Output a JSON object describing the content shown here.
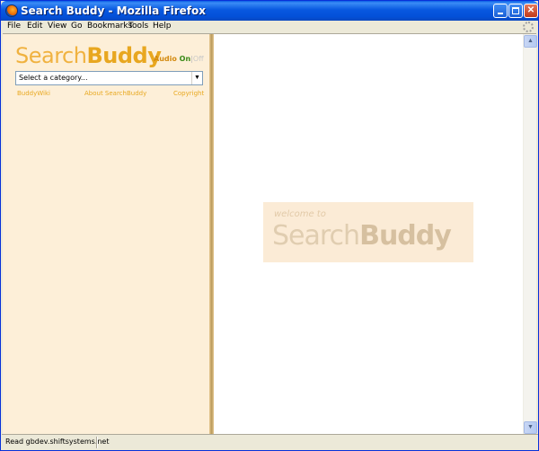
{
  "window": {
    "title": "Search Buddy - Mozilla Firefox",
    "controls": {
      "minimize": "minimize",
      "maximize": "maximize",
      "close": "✕"
    }
  },
  "menubar": {
    "items": [
      "File",
      "Edit",
      "View",
      "Go",
      "Bookmarks",
      "Tools",
      "Help"
    ]
  },
  "sidebar": {
    "logo_search": "Search",
    "logo_buddy": "Buddy",
    "audio_label": "Audio",
    "audio_on": "On",
    "audio_separator": "|",
    "audio_off": "Off",
    "category_select": {
      "selected": "Select a category..."
    },
    "links": [
      "BuddyWiki",
      "About SearchBuddy",
      "Copyright"
    ]
  },
  "main": {
    "welcome_prefix": "welcome to",
    "welcome_search": "Search",
    "welcome_buddy": "Buddy"
  },
  "statusbar": {
    "text": "Read gbdev.shiftsystems.net"
  },
  "colors": {
    "sidebar_bg": "#fdefd8",
    "logo_accent": "#e8a720",
    "audio_on": "#3a8a18",
    "link": "#e8a820"
  }
}
